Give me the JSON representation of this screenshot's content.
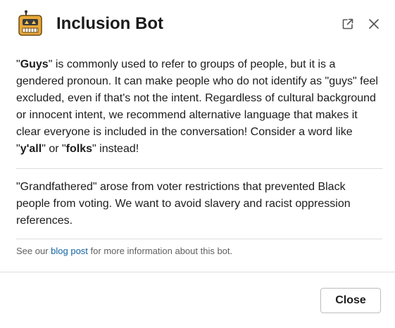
{
  "header": {
    "title": "Inclusion Bot",
    "avatar_icon": "robot-icon",
    "open_icon": "external-link-icon",
    "close_icon": "close-icon"
  },
  "message": {
    "para1": [
      {
        "text": "\"",
        "bold": false
      },
      {
        "text": "Guys",
        "bold": true
      },
      {
        "text": "\" is commonly used to refer to groups of people, but it is a gendered pronoun. It can make people who do not identify as \"guys\" feel excluded, even if that's not the intent. Regardless of cultural background or innocent intent, we recommend alternative language that makes it clear everyone is included in the conversation! Consider a word like \"",
        "bold": false
      },
      {
        "text": "y'all",
        "bold": true
      },
      {
        "text": "\" or \"",
        "bold": false
      },
      {
        "text": "folks",
        "bold": true
      },
      {
        "text": "\" instead!",
        "bold": false
      }
    ],
    "para2": "\"Grandfathered\" arose from voter restrictions that prevented Black people from voting. We want to avoid slavery and racist oppression references.",
    "footnote_prefix": "See our ",
    "footnote_link": "blog post",
    "footnote_suffix": " for more information about this bot."
  },
  "footer": {
    "close_label": "Close"
  },
  "colors": {
    "link": "#1264a3",
    "text": "#1d1c1d",
    "muted": "#616061",
    "avatar": "#e8a93a"
  }
}
